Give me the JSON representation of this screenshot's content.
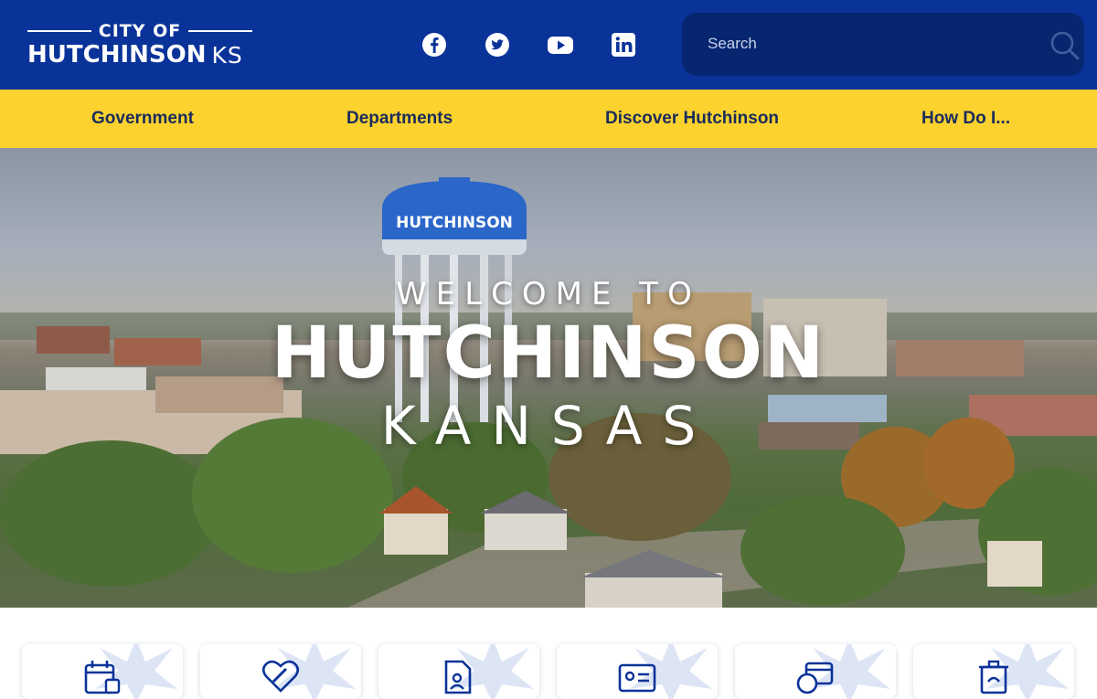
{
  "header": {
    "logo": {
      "top": "CITY OF",
      "main": "HUTCHINSON",
      "suffix": "KS"
    },
    "social": [
      {
        "name": "facebook-icon",
        "label": "Facebook"
      },
      {
        "name": "twitter-icon",
        "label": "Twitter"
      },
      {
        "name": "youtube-icon",
        "label": "YouTube"
      },
      {
        "name": "linkedin-icon",
        "label": "LinkedIn"
      }
    ],
    "search": {
      "placeholder": "Search",
      "value": ""
    }
  },
  "nav": {
    "items": [
      {
        "label": "Government"
      },
      {
        "label": "Departments"
      },
      {
        "label": "Discover Hutchinson"
      },
      {
        "label": "How Do I..."
      }
    ]
  },
  "hero": {
    "tower_label": "HUTCHINSON",
    "welcome": "WELCOME TO",
    "city": "HUTCHINSON",
    "state": "KANSAS"
  },
  "quick_links": {
    "icons": [
      "calendar-icon",
      "heart-wrench-icon",
      "document-user-icon",
      "id-card-icon",
      "payment-icon",
      "recycle-bin-icon"
    ]
  },
  "colors": {
    "header_blue": "#0a3399",
    "search_bg": "#062670",
    "nav_yellow": "#fbd22e",
    "nav_text": "#1a2b5c",
    "icon_blue": "#0a3399"
  }
}
